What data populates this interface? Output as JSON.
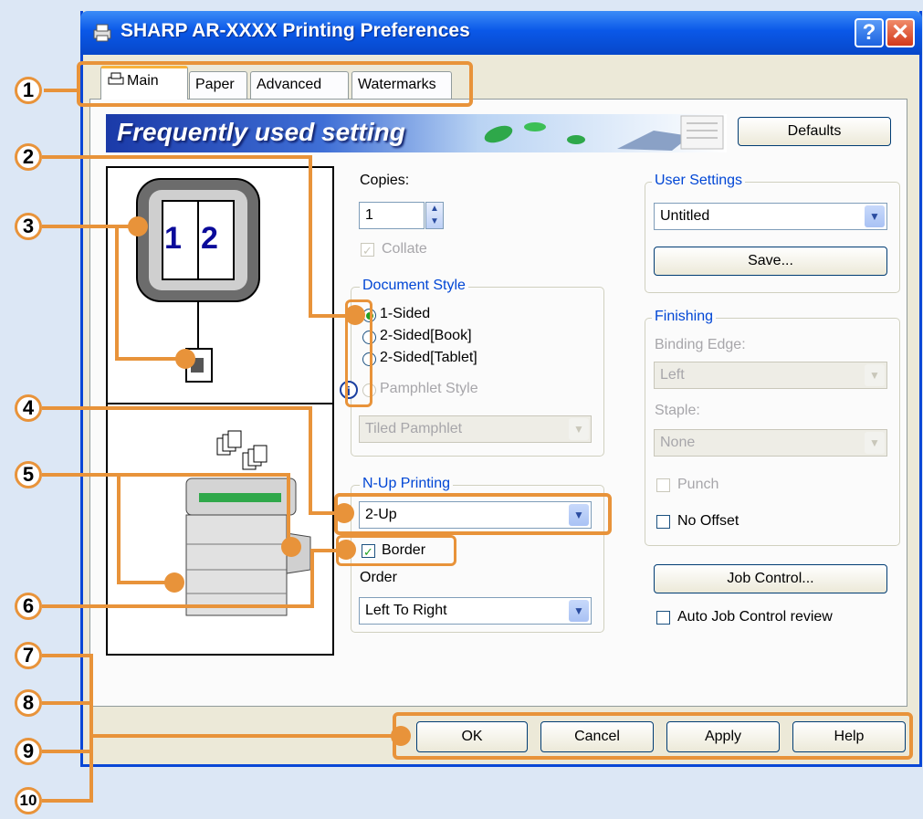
{
  "window": {
    "title": "SHARP AR-XXXX Printing Preferences",
    "help_btn": "?",
    "close_btn": "✕"
  },
  "tabs": [
    {
      "label": "Main"
    },
    {
      "label": "Paper"
    },
    {
      "label": "Advanced"
    },
    {
      "label": "Watermarks"
    }
  ],
  "banner": {
    "title": "Frequently used setting"
  },
  "defaults_btn": "Defaults",
  "preview": {
    "page_left": "1",
    "page_right": "2"
  },
  "copies": {
    "label": "Copies:",
    "value": "1"
  },
  "collate": {
    "label": "Collate",
    "checked": true
  },
  "document_style": {
    "legend": "Document Style",
    "options": [
      "1-Sided",
      "2-Sided[Book]",
      "2-Sided[Tablet]",
      "Pamphlet Style"
    ],
    "pamphlet_select": "Tiled Pamphlet"
  },
  "nup": {
    "legend": "N-Up Printing",
    "value": "2-Up",
    "border_label": "Border",
    "order_label": "Order",
    "order_value": "Left To Right"
  },
  "user_settings": {
    "legend": "User Settings",
    "value": "Untitled",
    "save_btn": "Save..."
  },
  "finishing": {
    "legend": "Finishing",
    "binding_label": "Binding Edge:",
    "binding_value": "Left",
    "staple_label": "Staple:",
    "staple_value": "None",
    "punch_label": "Punch",
    "offset_label": "No Offset"
  },
  "job_control_btn": "Job Control...",
  "auto_job_label": "Auto Job Control review",
  "footer": {
    "ok": "OK",
    "cancel": "Cancel",
    "apply": "Apply",
    "help": "Help"
  },
  "callouts": [
    "1",
    "2",
    "3",
    "4",
    "5",
    "6",
    "7",
    "8",
    "9",
    "10"
  ],
  "colors": {
    "accent": "#e8933a",
    "title_bar": "#0a58e8",
    "legend_text": "#0046d5"
  }
}
